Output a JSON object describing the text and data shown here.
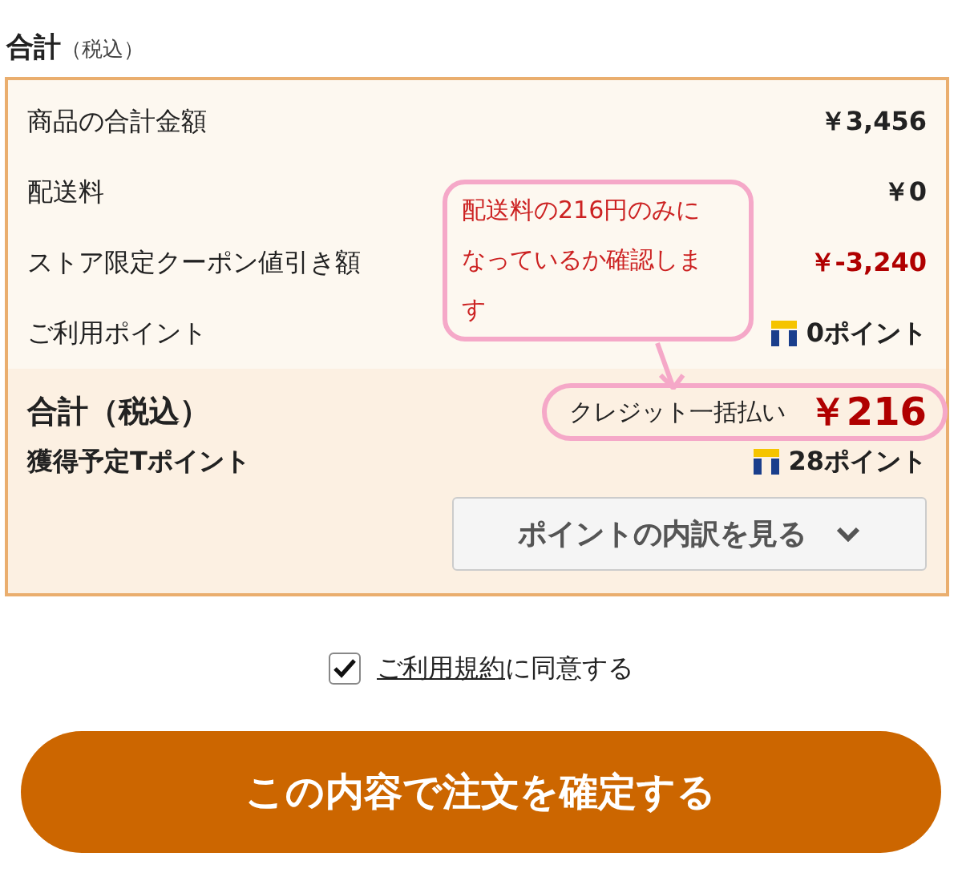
{
  "heading": {
    "title": "合計",
    "note": "（税込）"
  },
  "rows": [
    {
      "label": "商品の合計金額",
      "value": "￥3,456",
      "kind": "amount"
    },
    {
      "label": "配送料",
      "value": "￥0",
      "kind": "amount"
    },
    {
      "label": "ストア限定クーポン値引き額",
      "value": "￥-3,240",
      "kind": "discount"
    },
    {
      "label": "ご利用ポイント",
      "value": "0ポイント",
      "kind": "points"
    }
  ],
  "total": {
    "label": "合計（税込）",
    "payment": "クレジット一括払い",
    "amount": "￥216"
  },
  "earned": {
    "label": "獲得予定Tポイント",
    "value": "28ポイント"
  },
  "breakdown_button": {
    "label": "ポイントの内訳を見る"
  },
  "agreement": {
    "checked": true,
    "link": "ご利用規約",
    "text": "に同意する"
  },
  "confirm_button": {
    "label": "この内容で注文を確定する"
  },
  "annotation": {
    "note": "配送料の216円のみになっているか確認します"
  }
}
